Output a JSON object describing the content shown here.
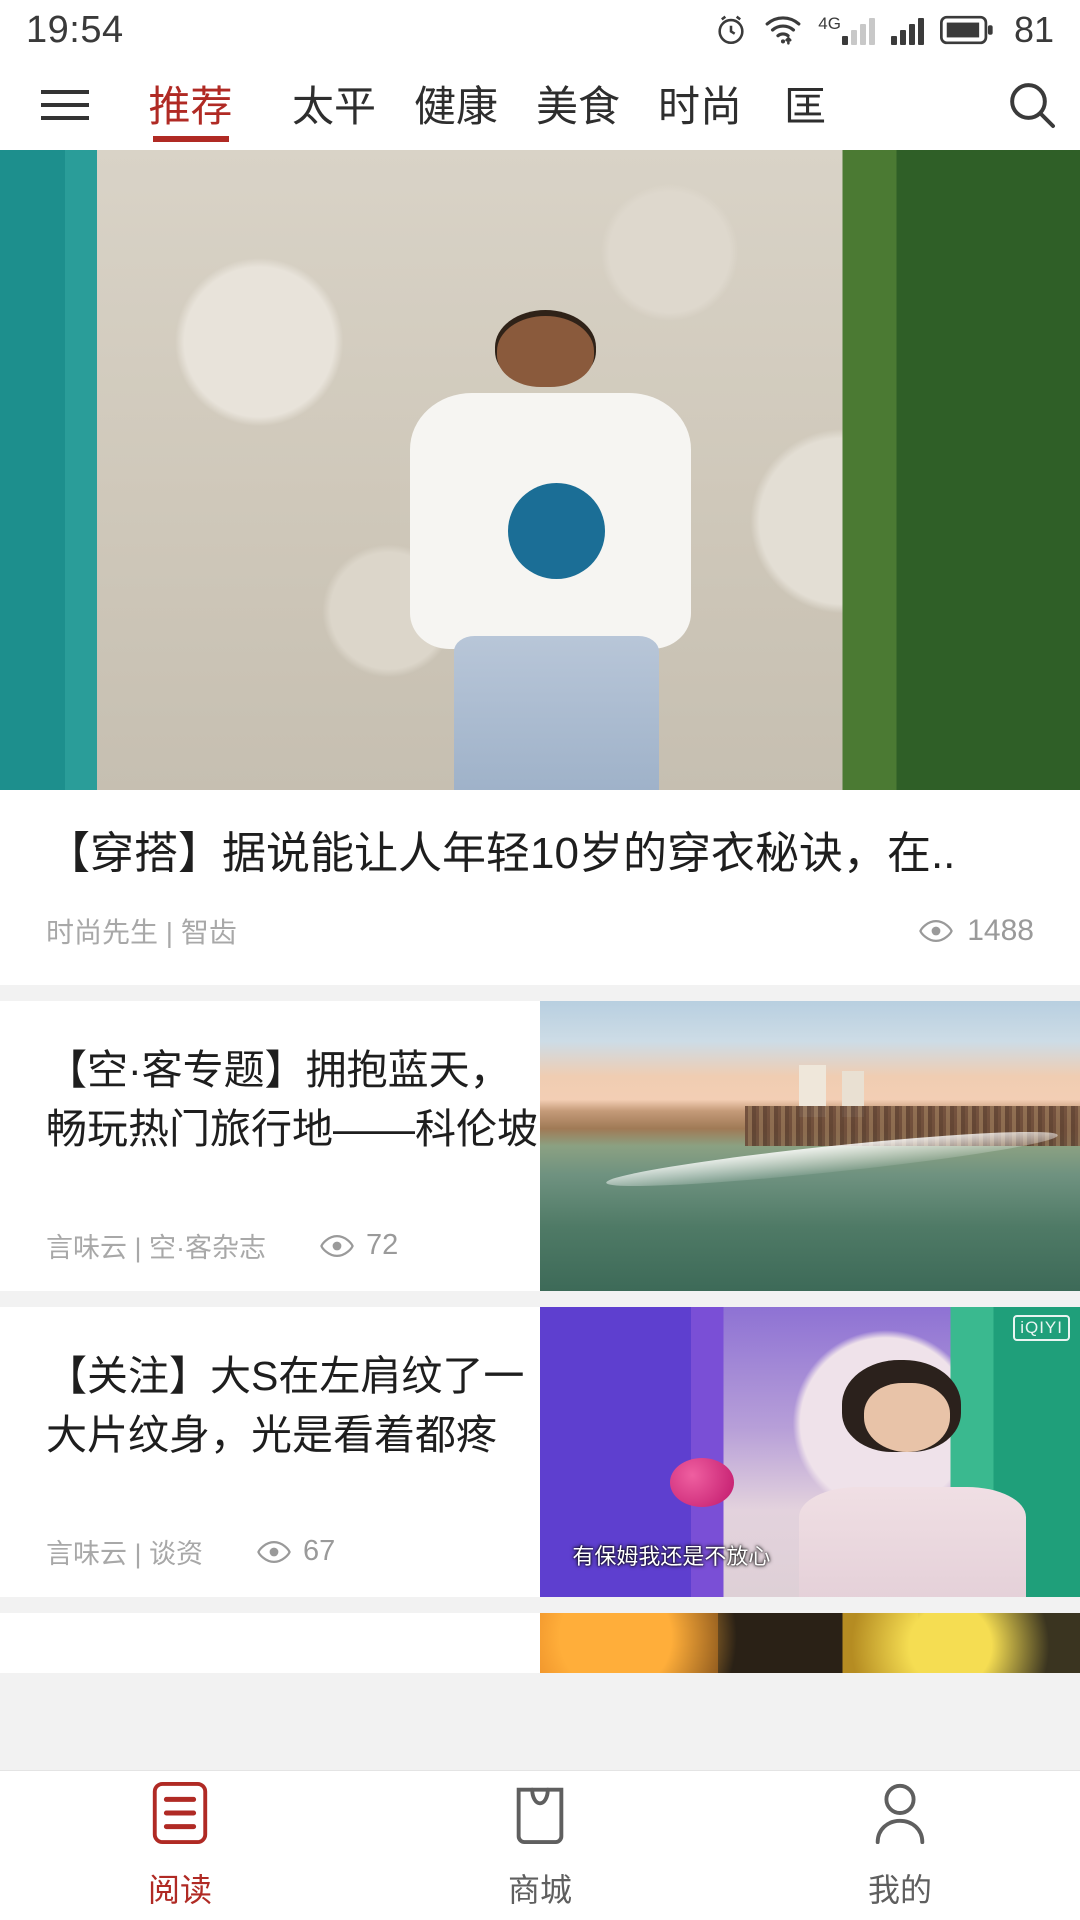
{
  "statusbar": {
    "time": "19:54",
    "battery_level": "81",
    "network_label": "4G",
    "icons": [
      "alarm-clock-icon",
      "wifi-icon",
      "signal-4g-icon",
      "signal-icon",
      "battery-icon"
    ]
  },
  "topnav": {
    "menu_icon": "hamburger-menu-icon",
    "search_icon": "search-icon",
    "tabs": [
      {
        "label": "推荐",
        "active": true
      },
      {
        "label": "太平",
        "active": false
      },
      {
        "label": "健康",
        "active": false
      },
      {
        "label": "美食",
        "active": false
      },
      {
        "label": "时尚",
        "active": false
      },
      {
        "label": "匡",
        "active": false
      }
    ]
  },
  "feed": {
    "separator_color": "#f2f2f2",
    "cards": [
      {
        "layout": "hero",
        "title": "【穿搭】据说能让人年轻10岁的穿衣秘诀，在..",
        "source": "时尚先生 | 智齿",
        "views": "1488",
        "views_icon": "eye-icon",
        "image_name": "fashion-man-photo"
      },
      {
        "layout": "row",
        "title": "【空·客专题】拥抱蓝天，畅玩热门旅行地——科伦坡",
        "source": "言味云 | 空·客杂志",
        "views": "72",
        "views_icon": "eye-icon",
        "image_name": "colombo-beach-photo"
      },
      {
        "layout": "row",
        "title": "【关注】大S在左肩纹了一大片纹身，光是看着都疼",
        "source": "言味云 | 谈资",
        "views": "67",
        "views_icon": "eye-icon",
        "image_name": "tv-interview-photo",
        "image_caption": "有保姆我还是不放心",
        "image_badge": "iQIYI"
      },
      {
        "layout": "row-partial",
        "image_name": "night-scene-photo"
      }
    ]
  },
  "bottomnav": {
    "items": [
      {
        "label": "阅读",
        "icon": "reading-list-icon",
        "active": true
      },
      {
        "label": "商城",
        "icon": "shopping-bag-icon",
        "active": false
      },
      {
        "label": "我的",
        "icon": "person-icon",
        "active": false
      }
    ]
  },
  "colors": {
    "accent": "#b02a24",
    "text_primary": "#1e1e1e",
    "text_muted": "#a8a8a8",
    "background": "#f2f2f2"
  }
}
